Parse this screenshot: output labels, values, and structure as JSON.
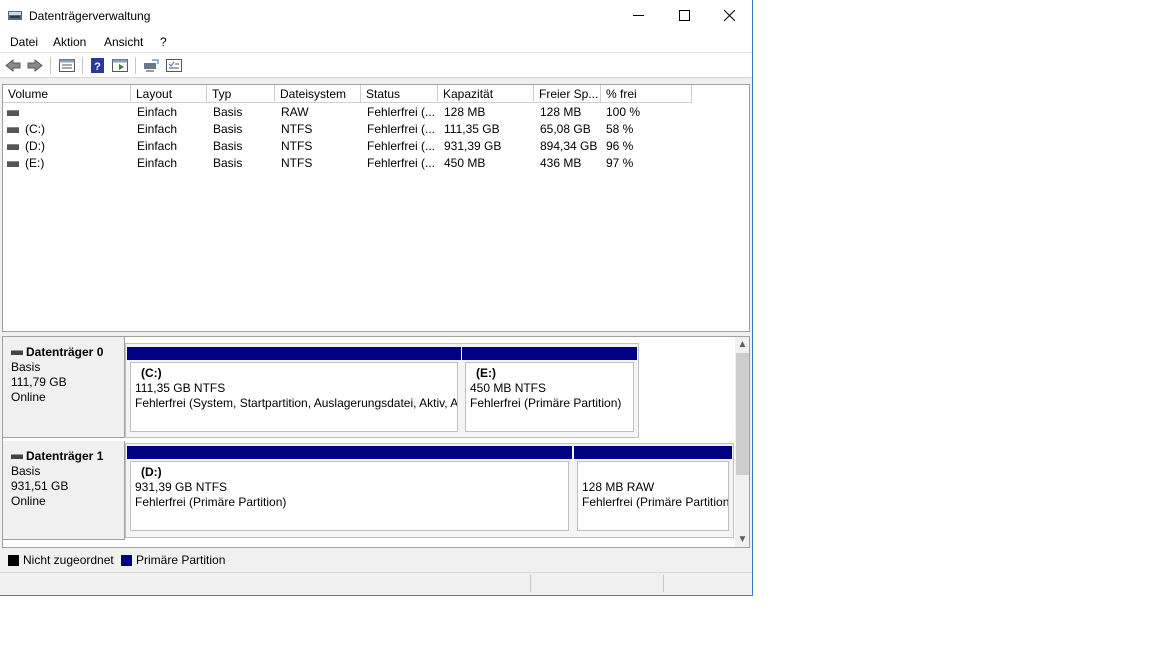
{
  "window": {
    "title": "Datenträgerverwaltung"
  },
  "menu": [
    "Datei",
    "Aktion",
    "Ansicht",
    "?"
  ],
  "toolbar_icons": [
    "back-arrow-icon",
    "forward-arrow-icon",
    "list-view-icon",
    "help-icon",
    "properties-icon",
    "console-icon",
    "settings-list-icon"
  ],
  "columns": [
    "Volume",
    "Layout",
    "Typ",
    "Dateisystem",
    "Status",
    "Kapazität",
    "Freier Sp...",
    "% frei"
  ],
  "volumes": [
    {
      "volume": "",
      "layout": "Einfach",
      "typ": "Basis",
      "fs": "RAW",
      "status": "Fehlerfrei (...",
      "kap": "128 MB",
      "frei": "128 MB",
      "pct": "100 %"
    },
    {
      "volume": "(C:)",
      "layout": "Einfach",
      "typ": "Basis",
      "fs": "NTFS",
      "status": "Fehlerfrei (...",
      "kap": "111,35 GB",
      "frei": "65,08 GB",
      "pct": "58 %"
    },
    {
      "volume": "(D:)",
      "layout": "Einfach",
      "typ": "Basis",
      "fs": "NTFS",
      "status": "Fehlerfrei (...",
      "kap": "931,39 GB",
      "frei": "894,34 GB",
      "pct": "96 %"
    },
    {
      "volume": "(E:)",
      "layout": "Einfach",
      "typ": "Basis",
      "fs": "NTFS",
      "status": "Fehlerfrei (...",
      "kap": "450 MB",
      "frei": "436 MB",
      "pct": "97 %"
    }
  ],
  "disks": [
    {
      "name": "Datenträger 0",
      "type": "Basis",
      "size": "111,79 GB",
      "state": "Online",
      "partitions": [
        {
          "title": "(C:)",
          "size": "111,35 GB NTFS",
          "status": "Fehlerfrei (System, Startpartition, Auslagerungsdatei, Aktiv, A"
        },
        {
          "title": "(E:)",
          "size": "450 MB NTFS",
          "status": "Fehlerfrei (Primäre Partition)"
        }
      ]
    },
    {
      "name": "Datenträger 1",
      "type": "Basis",
      "size": "931,51 GB",
      "state": "Online",
      "partitions": [
        {
          "title": "(D:)",
          "size": "931,39 GB NTFS",
          "status": "Fehlerfrei (Primäre Partition)"
        },
        {
          "title": "",
          "size": "128 MB RAW",
          "status": "Fehlerfrei (Primäre Partition"
        }
      ]
    }
  ],
  "legend": [
    {
      "label": "Nicht zugeordnet",
      "color": "#000000"
    },
    {
      "label": "Primäre Partition",
      "color": "#000080"
    }
  ]
}
